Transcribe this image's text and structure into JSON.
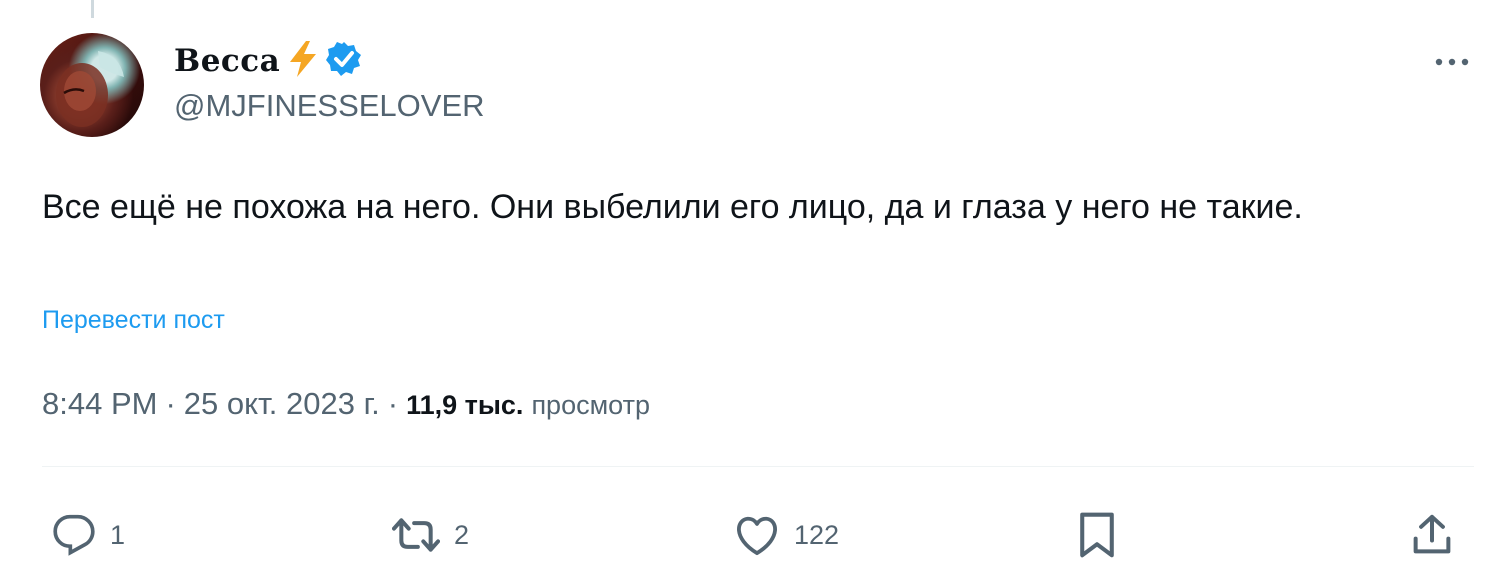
{
  "author": {
    "name": "Becca",
    "name_emoji": "⚡",
    "handle": "@MJFINESSELOVER"
  },
  "tweet": {
    "text": "Все ещё не похожа на него. Они выбелили его лицо, да и глаза у него не такие.",
    "translate_label": "Перевести пост"
  },
  "meta": {
    "time": "8:44 PM",
    "sep1": "·",
    "date": "25 окт. 2023 г.",
    "sep2": "·",
    "views_count": "11,9 тыс.",
    "views_label": "просмотр"
  },
  "actions": {
    "reply_count": "1",
    "retweet_count": "2",
    "like_count": "122"
  },
  "colors": {
    "accent": "#1d9bf0",
    "secondary_text": "#536471",
    "lightning": "#f5a623"
  },
  "icons": [
    "verified-badge-icon",
    "more-icon",
    "reply-icon",
    "retweet-icon",
    "like-icon",
    "bookmark-icon",
    "share-icon"
  ]
}
